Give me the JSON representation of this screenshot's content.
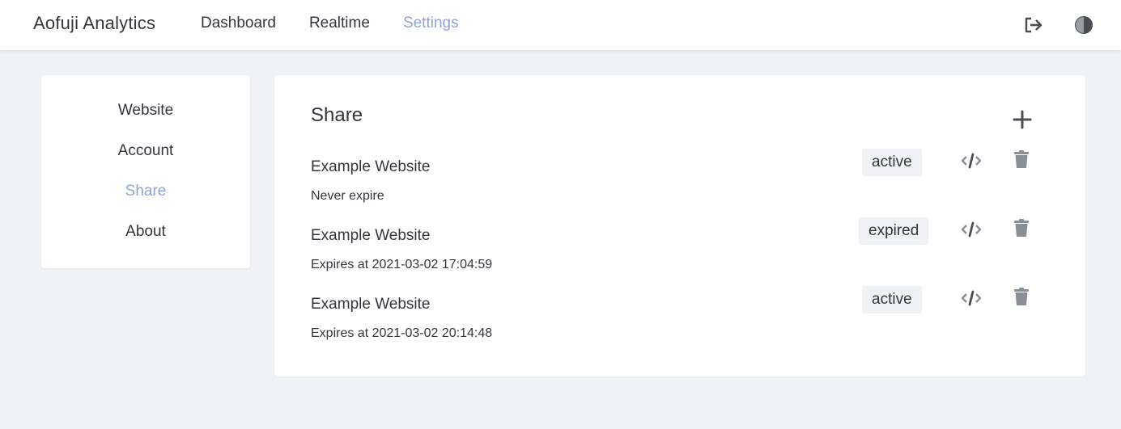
{
  "header": {
    "brand": "Aofuji Analytics",
    "nav": [
      {
        "label": "Dashboard",
        "active": false
      },
      {
        "label": "Realtime",
        "active": false
      },
      {
        "label": "Settings",
        "active": true
      }
    ],
    "icons": [
      "logout-icon",
      "theme-toggle-icon"
    ]
  },
  "sidebar": {
    "items": [
      {
        "label": "Website",
        "active": false
      },
      {
        "label": "Account",
        "active": false
      },
      {
        "label": "Share",
        "active": true
      },
      {
        "label": "About",
        "active": false
      }
    ]
  },
  "share": {
    "title": "Share",
    "add_icon": "plus-icon",
    "rows": [
      {
        "name": "Example Website",
        "status": "active",
        "expiry": "Never expire"
      },
      {
        "name": "Example Website",
        "status": "expired",
        "expiry": "Expires at 2021-03-02 17:04:59"
      },
      {
        "name": "Example Website",
        "status": "active",
        "expiry": "Expires at 2021-03-02 20:14:48"
      }
    ],
    "row_icons": [
      "code-icon",
      "trash-icon"
    ]
  },
  "colors": {
    "accent": "#8fa4d6",
    "text": "#33363d",
    "background": "#f0f2f6",
    "icon_gray": "#8a8e96"
  }
}
